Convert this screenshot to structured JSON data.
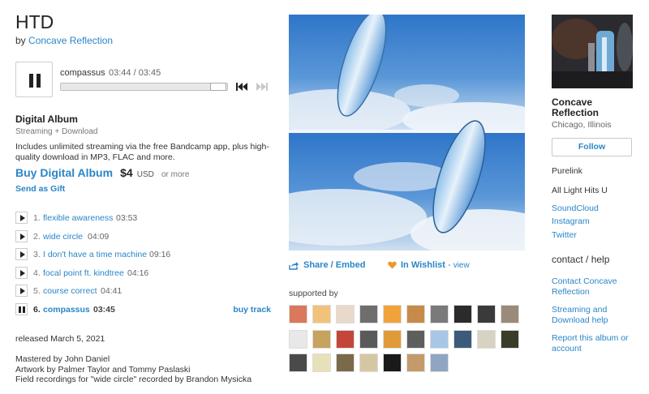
{
  "album": {
    "title": "HTD",
    "by_prefix": "by",
    "artist": "Concave Reflection"
  },
  "player": {
    "track_name": "compassus",
    "time": "03:44 / 03:45",
    "progress": 0.995,
    "state": "playing"
  },
  "format": {
    "title": "Digital Album",
    "subtitle": "Streaming + Download",
    "description": "Includes unlimited streaming via the free Bandcamp app, plus high-quality download in MP3, FLAC and more.",
    "buy_label": "Buy Digital Album",
    "price": "$4",
    "currency": "USD",
    "or_more": "or more",
    "gift_label": "Send as Gift"
  },
  "tracks": [
    {
      "num": "1.",
      "name": "flexible awareness",
      "time": "03:53"
    },
    {
      "num": "2.",
      "name": "wide circle",
      "time": "04:09"
    },
    {
      "num": "3.",
      "name": "I don't have a time machine",
      "time": "09:16"
    },
    {
      "num": "4.",
      "name": "focal point ft. kindtree",
      "time": "04:16"
    },
    {
      "num": "5.",
      "name": "course correct",
      "time": "04:41"
    },
    {
      "num": "6.",
      "name": "compassus",
      "time": "03:45",
      "current": true
    }
  ],
  "buy_track_label": "buy track",
  "released": "released March 5, 2021",
  "credits": [
    "Mastered by John Daniel",
    "Artwork by Palmer Taylor and Tommy Paslaski",
    "Field recordings for \"wide circle\" recorded by Brandon Mysicka"
  ],
  "actions": {
    "share_label": "Share / Embed",
    "wishlist_label": "In Wishlist",
    "wishlist_sep": " - ",
    "view_label": "view"
  },
  "supported_by_title": "supported by",
  "artist_panel": {
    "name": "Concave Reflection",
    "location": "Chicago, Illinois",
    "follow_label": "Follow",
    "links_plain": [
      "Purelink",
      "All Light Hits U"
    ],
    "links": [
      "SoundCloud",
      "Instagram",
      "Twitter"
    ],
    "contact_title": "contact / help",
    "help_links": [
      "Contact Concave Reflection",
      "Streaming and Download help",
      "Report this album or account"
    ]
  },
  "colors": {
    "link": "#2a86c8",
    "wishlist_heart": "#f0962b",
    "art_sky": "#7fb3e3"
  }
}
